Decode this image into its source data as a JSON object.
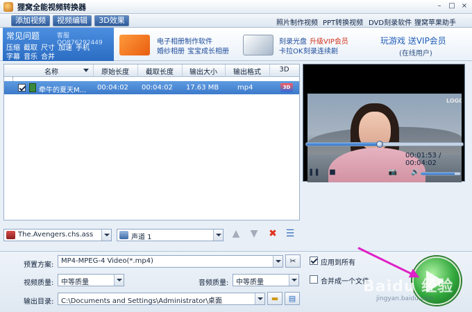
{
  "app": {
    "title": "狸窝全能视频转换器",
    "window_controls": [
      "–",
      "□",
      "×"
    ]
  },
  "toolbar": {
    "buttons": [
      "添加视频",
      "视频编辑",
      "3D效果"
    ],
    "links": [
      "照片制作视频",
      "PPT转换视频",
      "DVD刻录软件",
      "狸窝苹果助手"
    ]
  },
  "banner": {
    "faq_title": "常见问题",
    "faq_qq": "客服QQ876292449",
    "faq_links": [
      "压缩",
      "截取",
      "尺寸",
      "加速",
      "手机",
      "字幕",
      "音乐",
      "合并"
    ],
    "promo1": [
      "电子相册制作软件",
      "婚纱相册",
      "宝宝成长相册"
    ],
    "promo2_line1": "刻录光盘",
    "promo2_vip": "升级VIP会员",
    "promo2_line2": "卡拉OK",
    "promo2_line3": "刻录连续剧",
    "game_title": "玩游戏 送VIP会员",
    "game_sub": "(在线用户)"
  },
  "table": {
    "headers": [
      "名称",
      "原始长度",
      "截取长度",
      "输出大小",
      "输出格式",
      "3D"
    ],
    "rows": [
      {
        "name": "牵牛的夏天M...",
        "orig": "00:04:02",
        "cut": "00:04:02",
        "size": "17.63 MB",
        "format": "mp4",
        "badge": "3D"
      }
    ]
  },
  "subtitle": {
    "file": "The.Avengers.chs.ass"
  },
  "audio": {
    "track": "声道 1"
  },
  "preview": {
    "watermark": "LOGO",
    "time": "00:01:53 / 00:04:02",
    "progress": 0.47,
    "volume": 0.85
  },
  "settings": {
    "preset_label": "预置方案:",
    "preset_value": "MP4-MPEG-4 Video(*.mp4)",
    "video_quality_label": "视频质量:",
    "video_quality_value": "中等质量",
    "audio_quality_label": "音频质量:",
    "audio_quality_value": "中等质量",
    "output_dir_label": "输出目录:",
    "output_dir_value": "C:\\Documents and Settings\\Administrator\\桌面",
    "apply_all_label": "应用到所有",
    "merge_label": "合并成一个文件"
  },
  "watermark": {
    "brand": "Baidu 经验",
    "url": "jingyan.baidu.com"
  },
  "colors": {
    "accent_blue": "#2a6cc2",
    "convert_green": "#32a83d",
    "annotation_magenta": "#e020c8"
  }
}
